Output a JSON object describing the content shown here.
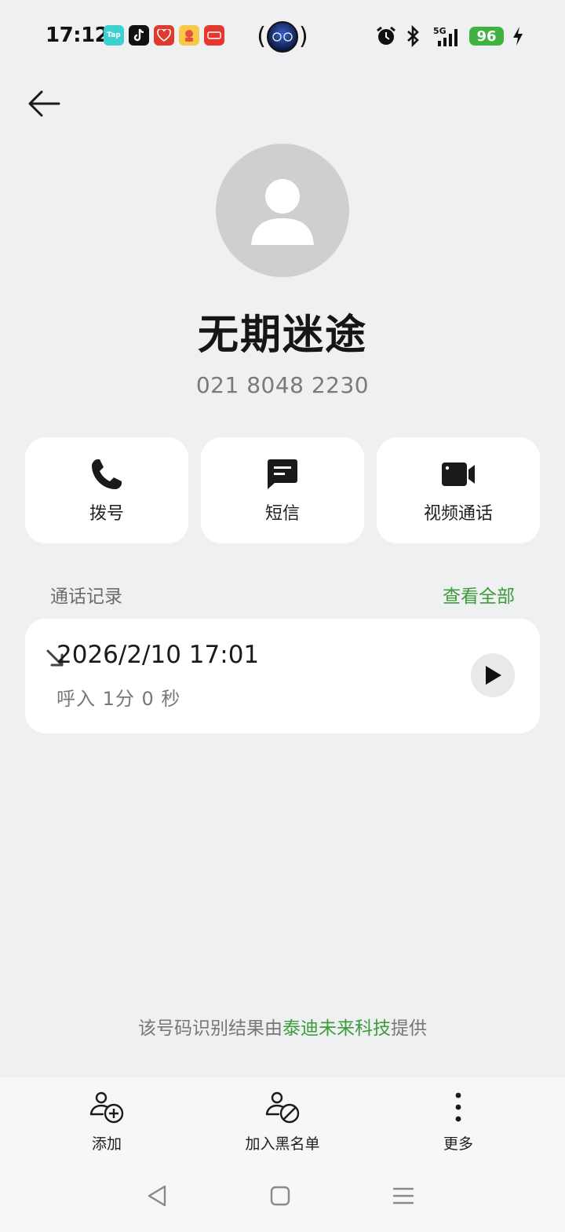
{
  "status_bar": {
    "time": "17:12",
    "notifications": [
      {
        "icon": "taptap-icon",
        "label": "Tap",
        "color": "#3fd0d0"
      },
      {
        "icon": "tiktok-icon",
        "label": "",
        "color": "#111111"
      },
      {
        "icon": "pinduoduo-icon",
        "label": "",
        "color": "#e0392e"
      },
      {
        "icon": "kuaishou-icon",
        "label": "",
        "color": "#f5a623"
      },
      {
        "icon": "app-red-icon",
        "label": "",
        "color": "#e5392f"
      }
    ],
    "battery": "96"
  },
  "contact": {
    "name": "无期迷途",
    "number": "021 8048 2230"
  },
  "actions": [
    {
      "label": "拨号",
      "icon": "phone-icon"
    },
    {
      "label": "短信",
      "icon": "message-icon"
    },
    {
      "label": "视频通话",
      "icon": "video-icon"
    }
  ],
  "call_log": {
    "title": "通话记录",
    "view_all": "查看全部",
    "entries": [
      {
        "datetime": "2026/2/10 17:01",
        "detail": "呼入 1分 0 秒",
        "direction": "incoming"
      }
    ]
  },
  "provider": {
    "prefix": "该号码识别结果由",
    "brand": "泰迪未来科技",
    "suffix": "提供"
  },
  "bottom_actions": [
    {
      "label": "添加",
      "icon": "add-contact-icon"
    },
    {
      "label": "加入黑名单",
      "icon": "block-contact-icon"
    },
    {
      "label": "更多",
      "icon": "more-vertical-icon"
    }
  ],
  "colors": {
    "accent": "#3e9b3b",
    "background": "#eff0f2",
    "card": "#ffffff"
  }
}
